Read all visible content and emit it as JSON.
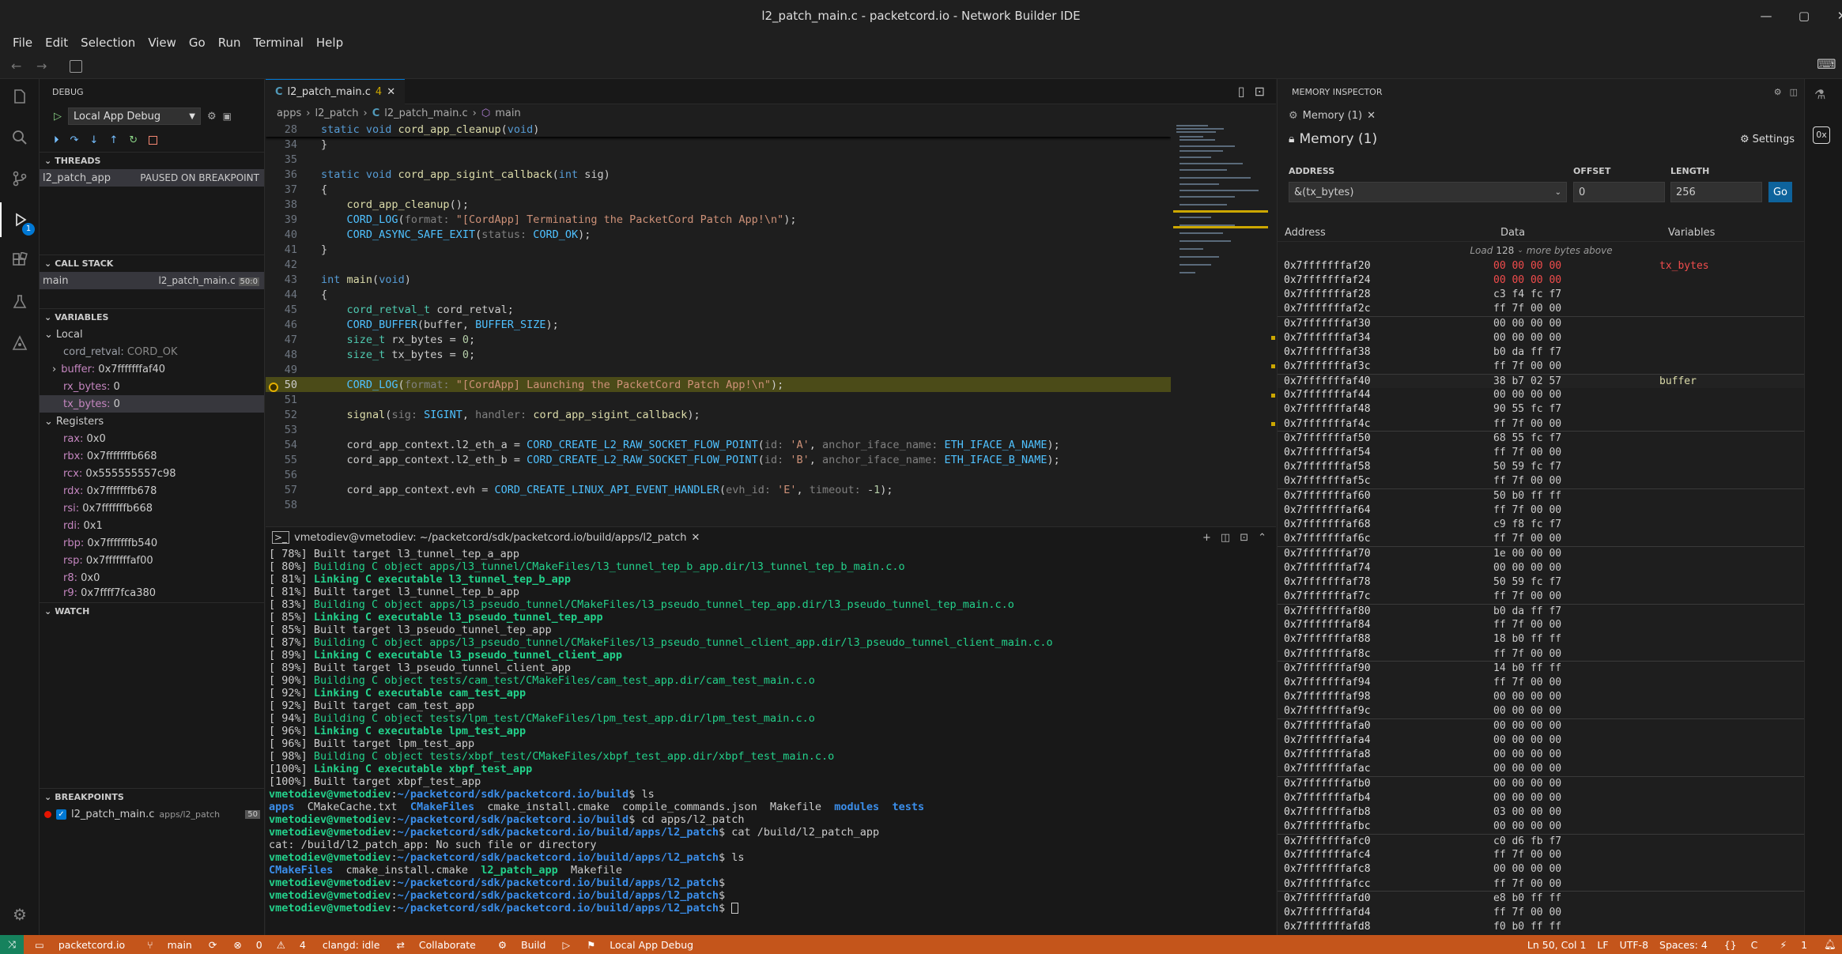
{
  "window": {
    "title": "l2_patch_main.c - packetcord.io - Network Builder IDE"
  },
  "menu": [
    "File",
    "Edit",
    "Selection",
    "View",
    "Go",
    "Run",
    "Terminal",
    "Help"
  ],
  "debug": {
    "header": "DEBUG",
    "config": "Local App Debug",
    "threads_header": "THREADS",
    "thread_name": "l2_patch_app",
    "thread_status": "PAUSED ON BREAKPOINT",
    "callstack_header": "CALL STACK",
    "frame_name": "main",
    "frame_file": "l2_patch_main.c",
    "frame_line": "50:0",
    "variables_header": "VARIABLES",
    "local_label": "Local",
    "locals": [
      {
        "name": "cord_retval:",
        "value": "CORD_OK"
      },
      {
        "name": "buffer:",
        "value": "0x7fffffffaf40"
      },
      {
        "name": "rx_bytes:",
        "value": "0"
      },
      {
        "name": "tx_bytes:",
        "value": "0"
      }
    ],
    "registers_label": "Registers",
    "registers": [
      {
        "name": "rax:",
        "value": "0x0"
      },
      {
        "name": "rbx:",
        "value": "0x7fffffffb668"
      },
      {
        "name": "rcx:",
        "value": "0x555555557c98"
      },
      {
        "name": "rdx:",
        "value": "0x7fffffffb678"
      },
      {
        "name": "rsi:",
        "value": "0x7fffffffb668"
      },
      {
        "name": "rdi:",
        "value": "0x1"
      },
      {
        "name": "rbp:",
        "value": "0x7fffffffb540"
      },
      {
        "name": "rsp:",
        "value": "0x7fffffffaf00"
      },
      {
        "name": "r8:",
        "value": "0x0"
      },
      {
        "name": "r9:",
        "value": "0x7ffff7fca380"
      }
    ],
    "watch_header": "WATCH",
    "breakpoints_header": "BREAKPOINTS",
    "bp_file": "l2_patch_main.c",
    "bp_path": "apps/l2_patch",
    "bp_line": "50",
    "debug_badge": "1"
  },
  "editor": {
    "tab": "l2_patch_main.c",
    "tab_count": "4",
    "breadcrumb": [
      "apps",
      "l2_patch",
      "l2_patch_main.c",
      "main"
    ],
    "sticky_line": "28",
    "sticky_text": "static void cord_app_cleanup(void)"
  },
  "terminal": {
    "tab": "vmetodiev@vmetodiev: ~/packetcord/sdk/packetcord.io/build/apps/l2_patch"
  },
  "memory": {
    "panel_title": "MEMORY INSPECTOR",
    "tab": "Memory (1)",
    "heading": "Memory (1)",
    "settings": "Settings",
    "address_label": "ADDRESS",
    "offset_label": "OFFSET",
    "length_label": "LENGTH",
    "address_value": "&(tx_bytes)",
    "offset_value": "0",
    "length_value": "256",
    "go": "Go",
    "col_address": "Address",
    "col_data": "Data",
    "col_variables": "Variables",
    "load_prefix": "Load",
    "load_count": "128",
    "load_suffix": "more bytes above",
    "rows": [
      [
        "0x7fffffffaf20",
        "00 00 00 00",
        "tx_bytes"
      ],
      [
        "0x7fffffffaf24",
        "00 00 00 00",
        ""
      ],
      [
        "0x7fffffffaf28",
        "c3 f4 fc f7",
        ""
      ],
      [
        "0x7fffffffaf2c",
        "ff 7f 00 00",
        ""
      ],
      [
        "0x7fffffffaf30",
        "00 00 00 00",
        ""
      ],
      [
        "0x7fffffffaf34",
        "00 00 00 00",
        ""
      ],
      [
        "0x7fffffffaf38",
        "b0 da ff f7",
        ""
      ],
      [
        "0x7fffffffaf3c",
        "ff 7f 00 00",
        ""
      ],
      [
        "0x7fffffffaf40",
        "38 b7 02 57",
        "buffer"
      ],
      [
        "0x7fffffffaf44",
        "00 00 00 00",
        ""
      ],
      [
        "0x7fffffffaf48",
        "90 55 fc f7",
        ""
      ],
      [
        "0x7fffffffaf4c",
        "ff 7f 00 00",
        ""
      ],
      [
        "0x7fffffffaf50",
        "68 55 fc f7",
        ""
      ],
      [
        "0x7fffffffaf54",
        "ff 7f 00 00",
        ""
      ],
      [
        "0x7fffffffaf58",
        "50 59 fc f7",
        ""
      ],
      [
        "0x7fffffffaf5c",
        "ff 7f 00 00",
        ""
      ],
      [
        "0x7fffffffaf60",
        "50 b0 ff ff",
        ""
      ],
      [
        "0x7fffffffaf64",
        "ff 7f 00 00",
        ""
      ],
      [
        "0x7fffffffaf68",
        "c9 f8 fc f7",
        ""
      ],
      [
        "0x7fffffffaf6c",
        "ff 7f 00 00",
        ""
      ],
      [
        "0x7fffffffaf70",
        "1e 00 00 00",
        ""
      ],
      [
        "0x7fffffffaf74",
        "00 00 00 00",
        ""
      ],
      [
        "0x7fffffffaf78",
        "50 59 fc f7",
        ""
      ],
      [
        "0x7fffffffaf7c",
        "ff 7f 00 00",
        ""
      ],
      [
        "0x7fffffffaf80",
        "b0 da ff f7",
        ""
      ],
      [
        "0x7fffffffaf84",
        "ff 7f 00 00",
        ""
      ],
      [
        "0x7fffffffaf88",
        "18 b0 ff ff",
        ""
      ],
      [
        "0x7fffffffaf8c",
        "ff 7f 00 00",
        ""
      ],
      [
        "0x7fffffffaf90",
        "14 b0 ff ff",
        ""
      ],
      [
        "0x7fffffffaf94",
        "ff 7f 00 00",
        ""
      ],
      [
        "0x7fffffffaf98",
        "00 00 00 00",
        ""
      ],
      [
        "0x7fffffffaf9c",
        "00 00 00 00",
        ""
      ],
      [
        "0x7fffffffafa0",
        "00 00 00 00",
        ""
      ],
      [
        "0x7fffffffafa4",
        "00 00 00 00",
        ""
      ],
      [
        "0x7fffffffafa8",
        "00 00 00 00",
        ""
      ],
      [
        "0x7fffffffafac",
        "00 00 00 00",
        ""
      ],
      [
        "0x7fffffffafb0",
        "00 00 00 00",
        ""
      ],
      [
        "0x7fffffffafb4",
        "00 00 00 00",
        ""
      ],
      [
        "0x7fffffffafb8",
        "03 00 00 00",
        ""
      ],
      [
        "0x7fffffffafbc",
        "00 00 00 00",
        ""
      ],
      [
        "0x7fffffffafc0",
        "c0 d6 fb f7",
        ""
      ],
      [
        "0x7fffffffafc4",
        "ff 7f 00 00",
        ""
      ],
      [
        "0x7fffffffafc8",
        "00 00 00 00",
        ""
      ],
      [
        "0x7fffffffafcc",
        "ff 7f 00 00",
        ""
      ],
      [
        "0x7fffffffafd0",
        "e8 b0 ff ff",
        ""
      ],
      [
        "0x7fffffffafd4",
        "ff 7f 00 00",
        ""
      ],
      [
        "0x7fffffffafd8",
        "f0 b0 ff ff",
        ""
      ]
    ]
  },
  "status": {
    "remote": "⤨",
    "project": "packetcord.io",
    "branch": "main",
    "errors": "0",
    "warnings": "4",
    "clangd": "clangd: idle",
    "collaborate": "Collaborate",
    "build": "Build",
    "debug_config": "Local App Debug",
    "position": "Ln 50, Col 1",
    "eol": "LF",
    "encoding": "UTF-8",
    "spaces": "Spaces: 4",
    "lang": "C",
    "ports": "1"
  }
}
